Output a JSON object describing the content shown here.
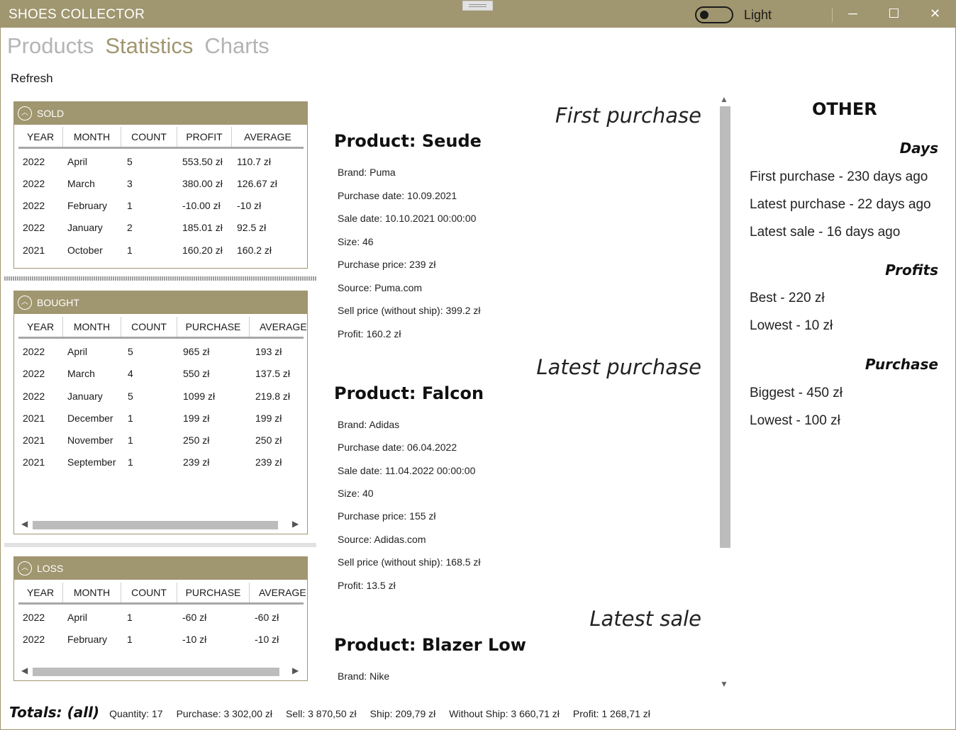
{
  "window": {
    "title": "SHOES COLLECTOR",
    "theme_label": "Light",
    "minimize": "─",
    "maximize": "☐",
    "close": "✕"
  },
  "nav": {
    "tabs": [
      {
        "label": "Products"
      },
      {
        "label": "Statistics"
      },
      {
        "label": "Charts"
      }
    ]
  },
  "toolbar": {
    "refresh": "Refresh"
  },
  "sold": {
    "title": "SOLD",
    "columns": [
      "YEAR",
      "MONTH",
      "COUNT",
      "PROFIT",
      "AVERAGE"
    ],
    "rows": [
      [
        "2022",
        "April",
        "5",
        "553.50 zł",
        "110.7 zł"
      ],
      [
        "2022",
        "March",
        "3",
        "380.00 zł",
        "126.67 zł"
      ],
      [
        "2022",
        "February",
        "1",
        "-10.00 zł",
        "-10 zł"
      ],
      [
        "2022",
        "January",
        "2",
        "185.01 zł",
        "92.5 zł"
      ],
      [
        "2021",
        "October",
        "1",
        "160.20 zł",
        "160.2 zł"
      ]
    ]
  },
  "bought": {
    "title": "BOUGHT",
    "columns": [
      "YEAR",
      "MONTH",
      "COUNT",
      "PURCHASE",
      "AVERAGE"
    ],
    "rows": [
      [
        "2022",
        "April",
        "5",
        "965 zł",
        "193 zł"
      ],
      [
        "2022",
        "March",
        "4",
        "550 zł",
        "137.5 zł"
      ],
      [
        "2022",
        "January",
        "5",
        "1099 zł",
        "219.8 zł"
      ],
      [
        "2021",
        "December",
        "1",
        "199 zł",
        "199 zł"
      ],
      [
        "2021",
        "November",
        "1",
        "250 zł",
        "250 zł"
      ],
      [
        "2021",
        "September",
        "1",
        "239 zł",
        "239 zł"
      ]
    ]
  },
  "loss": {
    "title": "LOSS",
    "columns": [
      "YEAR",
      "MONTH",
      "COUNT",
      "PURCHASE",
      "AVERAGE"
    ],
    "rows": [
      [
        "2022",
        "April",
        "1",
        "-60 zł",
        "-60 zł"
      ],
      [
        "2022",
        "February",
        "1",
        "-10 zł",
        "-10 zł"
      ]
    ]
  },
  "first_purchase": {
    "heading": "First purchase",
    "product": "Product: Seude",
    "details": [
      "Brand: Puma",
      "Purchase date: 10.09.2021",
      "Sale date: 10.10.2021 00:00:00",
      "Size: 46",
      "Purchase price: 239 zł",
      "Source: Puma.com",
      "Sell price (without ship): 399.2 zł",
      "Profit: 160.2 zł"
    ]
  },
  "latest_purchase": {
    "heading": "Latest purchase",
    "product": "Product: Falcon",
    "details": [
      "Brand: Adidas",
      "Purchase date: 06.04.2022",
      "Sale date: 11.04.2022 00:00:00",
      "Size: 40",
      "Purchase price: 155 zł",
      "Source: Adidas.com",
      "Sell price (without ship): 168.5 zł",
      "Profit: 13.5 zł"
    ]
  },
  "latest_sale": {
    "heading": "Latest sale",
    "product": "Product: Blazer Low",
    "details": [
      "Brand: Nike"
    ]
  },
  "other": {
    "title": "OTHER",
    "days_heading": "Days",
    "days": [
      "First purchase - 230 days ago",
      "Latest purchase - 22 days ago",
      "Latest sale - 16 days ago"
    ],
    "profits_heading": "Profits",
    "profits": [
      "Best - 220 zł",
      "Lowest - 10 zł"
    ],
    "purchase_heading": "Purchase",
    "purchase": [
      "Biggest - 450 zł",
      "Lowest - 100 zł"
    ]
  },
  "totals": {
    "label": "Totals: (all)",
    "quantity": "Quantity: 17",
    "purchase": "Purchase: 3 302,00 zł",
    "sell": "Sell: 3 870,50 zł",
    "ship": "Ship: 209,79 zł",
    "without_ship": "Without Ship: 3 660,71 zł",
    "profit": "Profit: 1 268,71 zł"
  },
  "colors": {
    "accent": "#a0966f",
    "inactive_tab": "#b4b4b4",
    "text": "#1a1a1a"
  },
  "icons": [
    "collapse-chevron-icon",
    "theme-toggle-icon",
    "minimize-icon",
    "maximize-icon",
    "close-icon",
    "scroll-left-icon",
    "scroll-right-icon",
    "scroll-up-icon",
    "scroll-down-icon"
  ]
}
